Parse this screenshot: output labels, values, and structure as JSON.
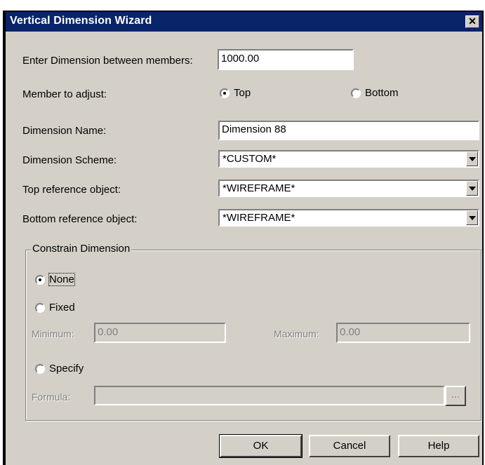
{
  "window": {
    "title": "Vertical Dimension Wizard",
    "close_glyph": "✕"
  },
  "dimension_between": {
    "label": "Enter Dimension between members:",
    "value": "1000.00"
  },
  "member_to_adjust": {
    "label": "Member to adjust:",
    "options": [
      "Top",
      "Bottom"
    ],
    "selected": "Top"
  },
  "dimension_name": {
    "label": "Dimension Name:",
    "value": "Dimension 88"
  },
  "dimension_scheme": {
    "label": "Dimension Scheme:",
    "value": "*CUSTOM*"
  },
  "top_reference": {
    "label": "Top reference object:",
    "value": "*WIREFRAME*"
  },
  "bottom_reference": {
    "label": "Bottom reference object:",
    "value": "*WIREFRAME*"
  },
  "constrain": {
    "title": "Constrain Dimension",
    "options": [
      "None",
      "Fixed",
      "Specify"
    ],
    "selected": "None",
    "minimum": {
      "label": "Minimum:",
      "value": "0.00"
    },
    "maximum": {
      "label": "Maximum:",
      "value": "0.00"
    },
    "formula": {
      "label": "Formula:",
      "value": "",
      "browse": "..."
    }
  },
  "buttons": {
    "ok": "OK",
    "cancel": "Cancel",
    "help": "Help"
  }
}
